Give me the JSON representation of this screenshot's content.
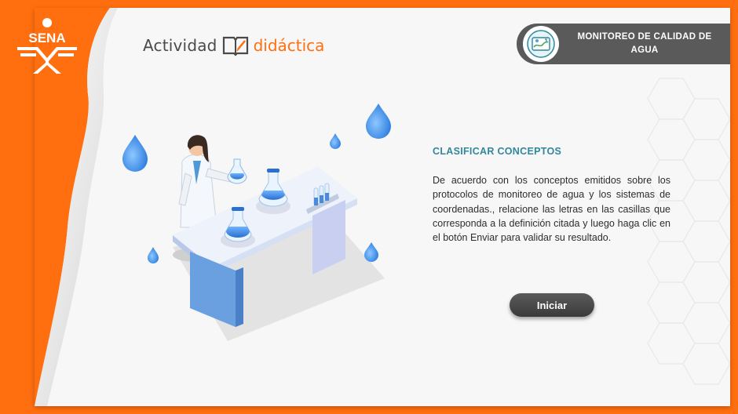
{
  "brand": {
    "sena_text": "SENA",
    "activity_word1": "Actividad",
    "activity_word2": "didáctica",
    "accent_color": "#ff6f0f"
  },
  "topic": {
    "title": "MONITOREO DE CALIDAD DE AGUA",
    "icon": "water-monitoring-icon"
  },
  "content": {
    "section_title": "CLASIFICAR CONCEPTOS",
    "instructions": "De acuerdo con los conceptos emitidos sobre los protocolos de monitoreo de agua y los sistemas de coordenadas., relacione las letras en las casillas que corresponda a la definición citada y luego haga clic en el botón Enviar para validar su resultado.",
    "title_color": "#31879c"
  },
  "actions": {
    "start_label": "Iniciar"
  },
  "illustration": {
    "subject": "scientist-lab-icon",
    "drops": "water-drop-icon"
  }
}
